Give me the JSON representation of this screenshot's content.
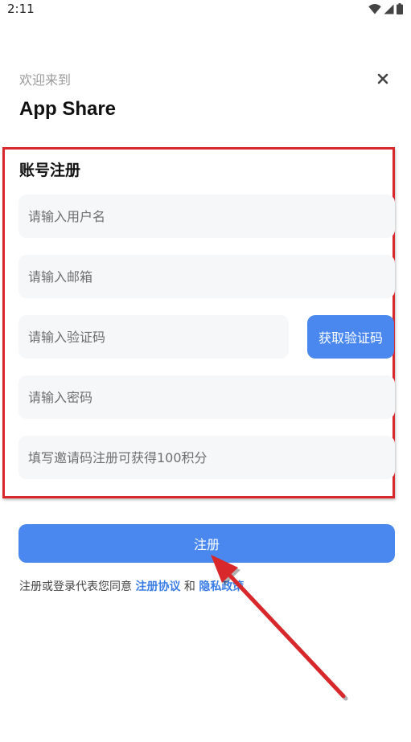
{
  "status_bar": {
    "time": "2:11",
    "icons": [
      "wifi-icon",
      "signal-icon",
      "battery-icon"
    ]
  },
  "header": {
    "welcome": "欢迎来到",
    "title": "App Share",
    "close_icon": "close-icon"
  },
  "form": {
    "title": "账号注册",
    "username_placeholder": "请输入用户名",
    "email_placeholder": "请输入邮箱",
    "code_placeholder": "请输入验证码",
    "get_code_label": "获取验证码",
    "password_placeholder": "请输入密码",
    "invite_placeholder": "填写邀请码注册可获得100积分"
  },
  "register_button": "注册",
  "agreement": {
    "prefix": "注册或登录代表您同意",
    "terms_link": "注册协议",
    "and": "和",
    "privacy_link": "隐私政策"
  },
  "colors": {
    "accent": "#4a88ef",
    "link": "#3a7de4",
    "highlight_border": "#d9282c",
    "field_bg": "#f6f7f9"
  }
}
